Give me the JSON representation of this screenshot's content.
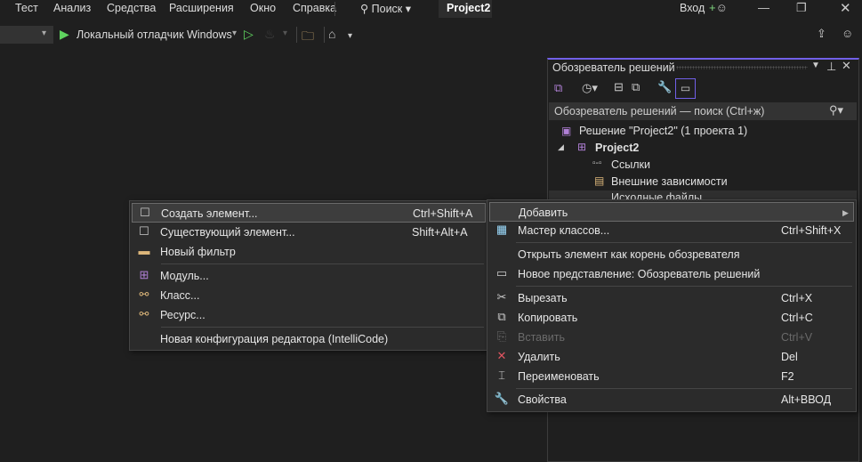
{
  "menubar": {
    "items": [
      "Тест",
      "Анализ",
      "Средства",
      "Расширения",
      "Окно",
      "Справка"
    ],
    "search": "Поиск",
    "project_tab": "Project2",
    "signin": "Вход"
  },
  "toolbar": {
    "debugger": "Локальный отладчик Windows"
  },
  "solution_explorer": {
    "title": "Обозреватель решений",
    "search_placeholder": "Обозреватель решений — поиск (Ctrl+ж)",
    "tree": [
      "Решение \"Project2\"  (1 проекта 1)",
      "Project2",
      "Ссылки",
      "Внешние зависимости",
      "Исходные файлы"
    ]
  },
  "add_submenu": {
    "items": [
      {
        "label": "Создать элемент...",
        "shortcut": "Ctrl+Shift+A",
        "icon": "new-item-icon"
      },
      {
        "label": "Существующий элемент...",
        "shortcut": "Shift+Alt+A",
        "icon": "existing-item-icon"
      },
      {
        "label": "Новый фильтр",
        "shortcut": "",
        "icon": "new-filter-icon"
      },
      {
        "label": "Модуль...",
        "shortcut": "",
        "icon": "module-icon"
      },
      {
        "label": "Класс...",
        "shortcut": "",
        "icon": "class-icon"
      },
      {
        "label": "Ресурс...",
        "shortcut": "",
        "icon": "resource-icon"
      },
      {
        "label": "Новая конфигурация редактора (IntelliCode)",
        "shortcut": "",
        "icon": ""
      }
    ]
  },
  "context_menu": {
    "items": [
      {
        "label": "Добавить",
        "shortcut": "",
        "icon": ""
      },
      {
        "label": "Мастер классов...",
        "shortcut": "Ctrl+Shift+X",
        "icon": "class-wizard-icon"
      },
      {
        "label": "Открыть элемент как корень обозревателя",
        "shortcut": "",
        "icon": ""
      },
      {
        "label": "Новое представление: Обозреватель решений",
        "shortcut": "",
        "icon": "new-view-icon"
      },
      {
        "label": "Вырезать",
        "shortcut": "Ctrl+X",
        "icon": "cut-icon"
      },
      {
        "label": "Копировать",
        "shortcut": "Ctrl+C",
        "icon": "copy-icon"
      },
      {
        "label": "Вставить",
        "shortcut": "Ctrl+V",
        "icon": "paste-icon"
      },
      {
        "label": "Удалить",
        "shortcut": "Del",
        "icon": "delete-icon"
      },
      {
        "label": "Переименовать",
        "shortcut": "F2",
        "icon": "rename-icon"
      },
      {
        "label": "Свойства",
        "shortcut": "Alt+ВВОД",
        "icon": "properties-icon"
      }
    ]
  }
}
